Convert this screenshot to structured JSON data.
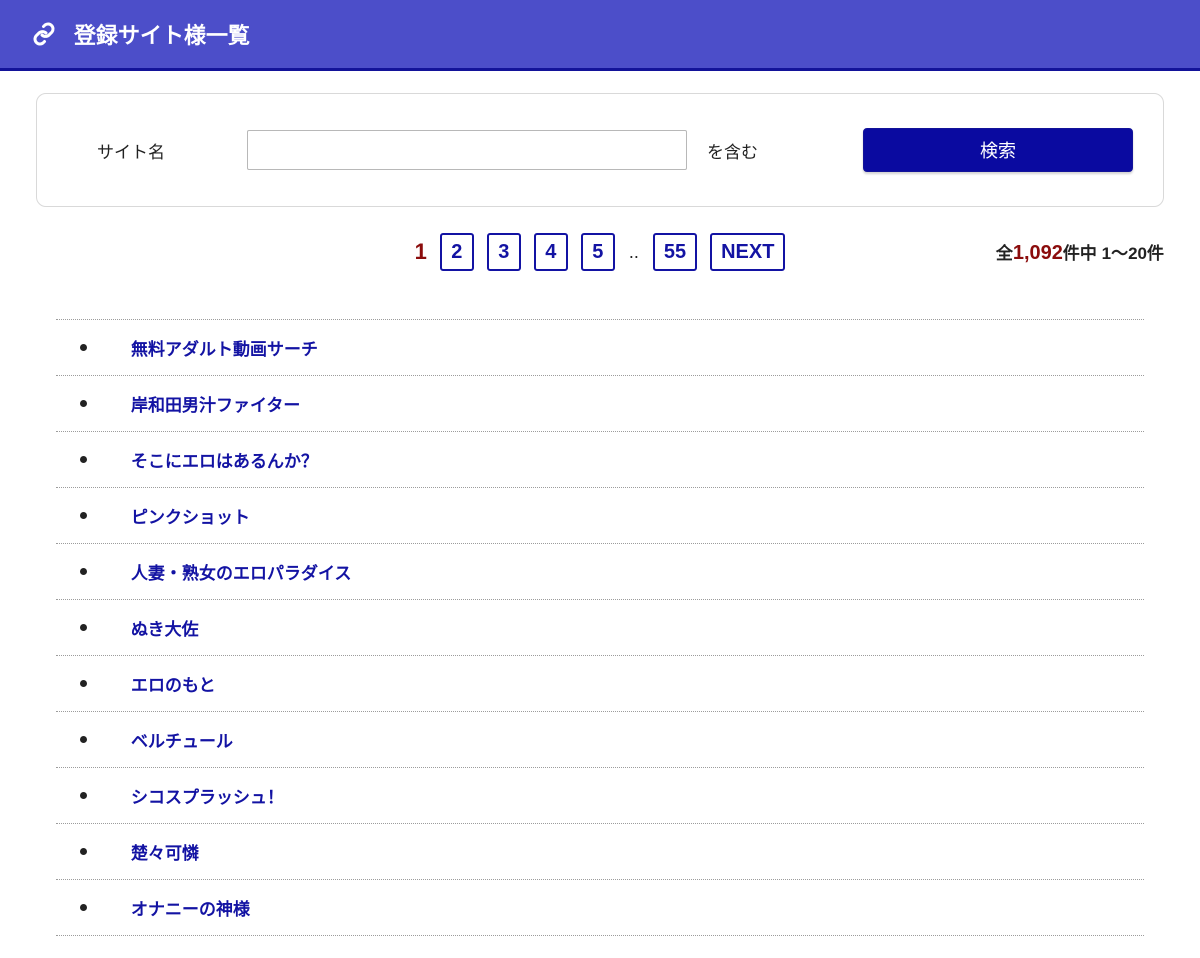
{
  "header": {
    "title": "登録サイト様一覧"
  },
  "search": {
    "label": "サイト名",
    "value": "",
    "suffix": "を含む",
    "button": "検索"
  },
  "pager": {
    "pages": [
      {
        "label": "1",
        "current": true
      },
      {
        "label": "2",
        "current": false
      },
      {
        "label": "3",
        "current": false
      },
      {
        "label": "4",
        "current": false
      },
      {
        "label": "5",
        "current": false
      },
      {
        "label": "..",
        "ellipsis": true
      },
      {
        "label": "55",
        "current": false
      },
      {
        "label": "NEXT",
        "current": false
      }
    ]
  },
  "count": {
    "prefix": "全",
    "total": "1,092",
    "mid": "件中 ",
    "range": "1〜20",
    "suffix": "件"
  },
  "sites": [
    "無料アダルト動画サーチ",
    "岸和田男汁ファイター",
    "そこにエロはあるんか？",
    "ピンクショット",
    "人妻・熟女のエロパラダイス",
    "ぬき大佐",
    "エロのもと",
    "ベルチュール",
    "シコスプラッシュ！",
    "楚々可憐",
    "オナニーの神様"
  ]
}
